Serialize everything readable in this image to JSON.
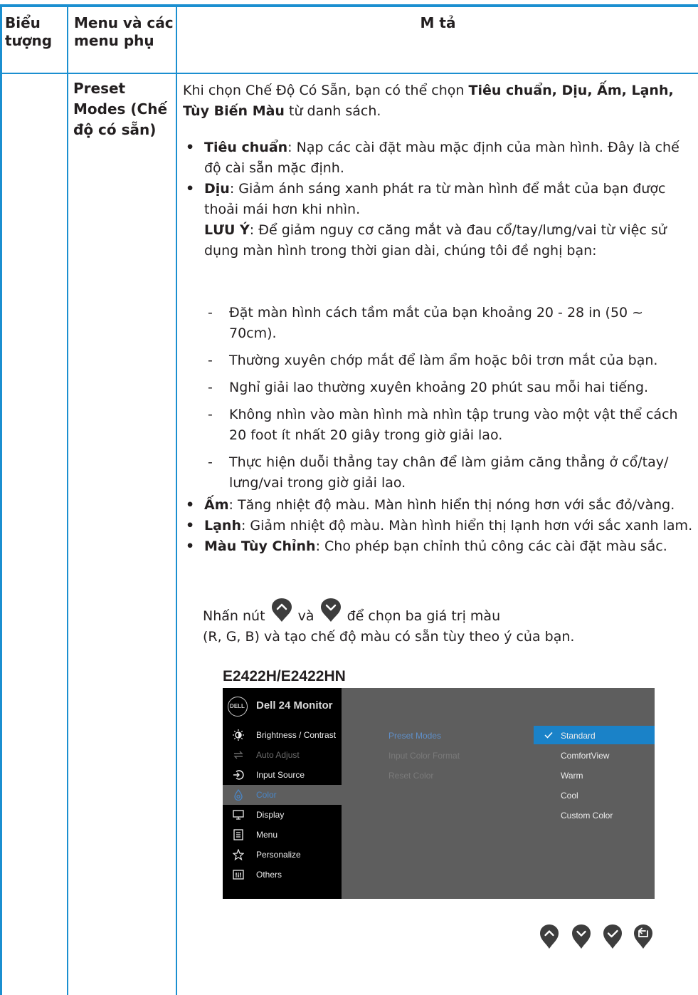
{
  "header": {
    "col_icon": "Biểu tượng",
    "col_menu": "Menu và các menu phụ",
    "col_desc": "M tả"
  },
  "row": {
    "menu_name": "Preset Modes (Chế độ có sẵn)",
    "intro_before": "Khi chọn Chế Độ Có Sẵn, bạn có thể chọn ",
    "intro_bold": "Tiêu chuẩn, Dịu, Ấm, Lạnh, Tùy Biến Màu",
    "intro_after": " từ danh sách.",
    "bullets_a": [
      {
        "term": "Tiêu chuẩn",
        "text": ": Nạp các cài đặt màu mặc định của màn hình. Đây là chế độ cài sẵn mặc định."
      },
      {
        "term": "Dịu",
        "text": ": Giảm ánh sáng xanh phát ra từ màn hình để mắt của bạn được thoải mái hơn khi nhìn."
      }
    ],
    "note_term": "LƯU Ý",
    "note_text": ": Để giảm nguy cơ căng mắt và đau cổ/tay/lưng/vai từ việc sử dụng màn hình trong thời gian dài, chúng tôi đề nghị bạn:",
    "dashes": [
      "Đặt màn hình cách tầm mắt của bạn khoảng 20 - 28 in (50 ~ 70cm).",
      "Thường xuyên chớp mắt để làm ẩm hoặc bôi trơn mắt của bạn.",
      "Nghỉ giải lao thường xuyên khoảng 20 phút sau mỗi hai tiếng.",
      "Không nhìn vào màn hình mà nhìn tập trung vào một vật thể cách 20 foot ít nhất 20 giây trong giờ giải lao.",
      "Thực hiện duỗi thẳng tay chân để làm giảm căng thẳng ở cổ/tay/ lưng/vai trong giờ giải lao."
    ],
    "bullets_b": [
      {
        "term": "Ấm",
        "text": ": Tăng nhiệt độ màu. Màn hình hiển thị nóng hơn với sắc đỏ/vàng."
      },
      {
        "term": "Lạnh",
        "text": ": Giảm nhiệt độ màu. Màn hình hiển thị lạnh hơn với sắc xanh lam."
      },
      {
        "term": "Màu Tùy Chỉnh",
        "text": ": Cho phép bạn chỉnh thủ công các cài đặt màu sắc."
      }
    ],
    "press_1": "Nhấn nút",
    "press_2": "và",
    "press_3": "để chọn ba giá trị màu",
    "press_line2": "(R, G, B) và tạo chế độ màu có sẵn tùy theo ý của bạn."
  },
  "osd": {
    "model": "E2422H/E2422HN",
    "logo": "DELL",
    "title": "Dell 24 Monitor",
    "menu": [
      {
        "label": "Brightness / Contrast",
        "icon": "brightness-icon",
        "state": "normal"
      },
      {
        "label": "Auto Adjust",
        "icon": "auto-adjust-icon",
        "state": "dim"
      },
      {
        "label": "Input Source",
        "icon": "input-source-icon",
        "state": "normal"
      },
      {
        "label": "Color",
        "icon": "color-icon",
        "state": "selected"
      },
      {
        "label": "Display",
        "icon": "display-icon",
        "state": "normal"
      },
      {
        "label": "Menu",
        "icon": "menu-icon",
        "state": "normal"
      },
      {
        "label": "Personalize",
        "icon": "star-icon",
        "state": "normal"
      },
      {
        "label": "Others",
        "icon": "others-icon",
        "state": "normal"
      }
    ],
    "submenu": [
      "Preset Modes",
      "Input Color Format",
      "Reset Color"
    ],
    "options": [
      "Standard",
      "ComfortView",
      "Warm",
      "Cool",
      "Custom Color"
    ],
    "selected_option": "Standard",
    "buttons": [
      "up-arrow-icon",
      "down-arrow-icon",
      "checkmark-icon",
      "back-icon"
    ]
  },
  "colors": {
    "rule": "#1b8fd0",
    "osd_highlight": "#1a82c8",
    "osd_panel": "#5e5e5e"
  }
}
